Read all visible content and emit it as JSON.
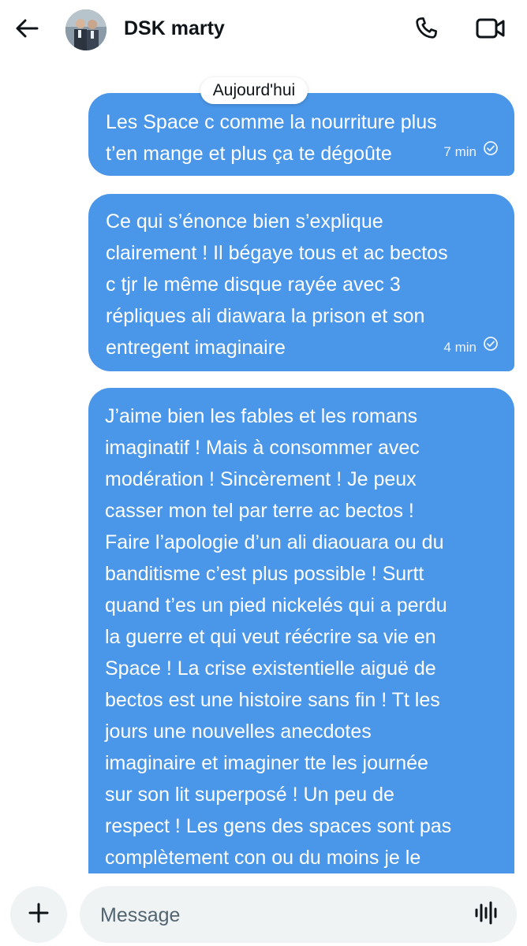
{
  "header": {
    "contact_name": "DSK marty"
  },
  "icons": {
    "back": "arrow-left-icon",
    "call": "phone-icon",
    "video": "video-camera-icon",
    "add": "plus-icon",
    "voice": "voice-waveform-icon",
    "read": "check-circle-icon"
  },
  "conversation": {
    "date_label": "Aujourd'hui",
    "messages": [
      {
        "text": "Les Space c comme la nourriture plus\nt’en mange et plus ça te dégoûte",
        "time": "7 min"
      },
      {
        "text": "Ce qui s’énonce bien s’explique\nclairement ! Il bégaye tous et ac bectos\nc tjr le même disque rayée avec 3\nrépliques ali diawara la prison et son\nentregent imaginaire",
        "time": "4 min"
      },
      {
        "text": "J’aime bien les fables et les romans\nimaginatif ! Mais à consommer avec\nmodération ! Sincèrement ! Je peux\ncasser mon tel par terre ac bectos !\nFaire l’apologie d’un ali diaouara ou du\nbanditisme c’est plus possible ! Surtt\nquand t’es un pied nickelés qui a perdu\nla guerre et qui veut réécrire sa vie en\nSpace ! La crise existentielle aiguë de\nbectos est une histoire sans fin ! Tt les\njours une nouvelles anecdotes\nimaginaire et imaginer tte les journée\nsur son lit superposé ! Un peu de\nrespect ! Les gens des spaces sont pas\ncomplètement con ou du moins je le"
      }
    ]
  },
  "composer": {
    "placeholder": "Message"
  },
  "colors": {
    "bubble": "#4a96e8",
    "field": "#eff3f4",
    "text": "#0f1419"
  }
}
